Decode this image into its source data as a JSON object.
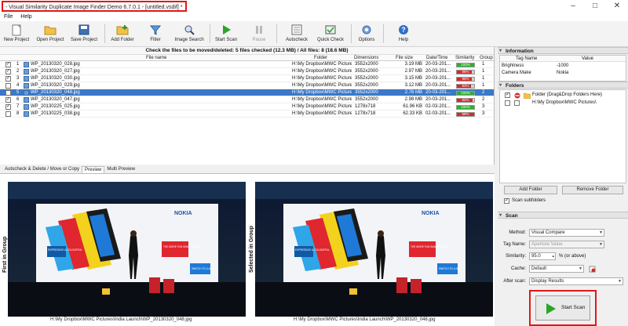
{
  "window": {
    "title": "- Visual Similarity Duplicate Image Finder Demo 6.7.0.1 - [untitled.vsdif] *",
    "minimize_glyph": "–",
    "maximize_glyph": "□",
    "close_glyph": "✕"
  },
  "menu": [
    "File",
    "Help"
  ],
  "toolbar": [
    {
      "label": "New Project",
      "icon": "new-project-icon"
    },
    {
      "label": "Open Project",
      "icon": "open-folder-icon"
    },
    {
      "label": "Save Project",
      "icon": "save-disk-icon"
    },
    {
      "label": "Add Folder",
      "icon": "add-folder-icon"
    },
    {
      "label": "Filter",
      "icon": "funnel-icon"
    },
    {
      "label": "Image Search",
      "icon": "magnifier-icon"
    },
    {
      "label": "Start Scan",
      "icon": "play-icon"
    },
    {
      "label": "Pause",
      "icon": "pause-icon"
    },
    {
      "label": "Autocheck",
      "icon": "autocheck-icon"
    },
    {
      "label": "Quick Check",
      "icon": "quick-check-icon"
    },
    {
      "label": "Options",
      "icon": "options-icon"
    },
    {
      "label": "Help",
      "icon": "help-icon"
    }
  ],
  "file_table": {
    "caption": "Check the files to be moved/deleted: 5 files checked (12.3 MB) / All files: 8 (18.6 MB)",
    "headers": {
      "filename": "File name",
      "folder": "Folder",
      "dimensions": "Dimensions",
      "filesize": "File size",
      "datetime": "Date/Time",
      "similarity": "Similarity",
      "group": "Group"
    },
    "rows": [
      {
        "checked": true,
        "index": "1",
        "name": "WP_20130320_028.jpg",
        "folder": "H:\\My Dropbox\\MWC Pictures\\Ind...",
        "dimensions": "3552x2000",
        "size": "3.19 MB",
        "date": "20-03-201...",
        "similarity": "100%",
        "sim_level": 1.0,
        "sim_color": "#2fae2f",
        "group": "1",
        "selected": false
      },
      {
        "checked": true,
        "index": "2",
        "name": "WP_20130320_027.jpg",
        "folder": "H:\\My Dropbox\\MWC Pictures\\Ind...",
        "dimensions": "3552x2000",
        "size": "2.97 MB",
        "date": "20-03-201...",
        "similarity": "86%",
        "sim_level": 0.86,
        "sim_color": "#d42a2a",
        "group": "1",
        "selected": false
      },
      {
        "checked": true,
        "index": "3",
        "name": "WP_20130320_030.jpg",
        "folder": "H:\\My Dropbox\\MWC Pictures\\Ind...",
        "dimensions": "3552x2000",
        "size": "3.15 MB",
        "date": "20-03-201...",
        "similarity": "85%",
        "sim_level": 0.85,
        "sim_color": "#d42a2a",
        "group": "1",
        "selected": false
      },
      {
        "checked": false,
        "index": "4",
        "name": "WP_20130320_029.jpg",
        "folder": "H:\\My Dropbox\\MWC Pictures\\Ind...",
        "dimensions": "3552x2000",
        "size": "3.12 MB",
        "date": "20-03-201...",
        "similarity": "83%",
        "sim_level": 0.83,
        "sim_color": "#d42a2a",
        "group": "1",
        "selected": false
      },
      {
        "checked": false,
        "index": "5",
        "name": "WP_20130320_048.jpg",
        "folder": "H:\\My Dropbox\\MWC Pictures\\Ind...",
        "dimensions": "3552x2000",
        "size": "2.76 MB",
        "date": "20-03-201...",
        "similarity": "100%",
        "sim_level": 1.0,
        "sim_color": "#2fae2f",
        "group": "2",
        "selected": true
      },
      {
        "checked": true,
        "index": "6",
        "name": "WP_20130320_047.jpg",
        "folder": "H:\\My Dropbox\\MWC Pictures\\Ind...",
        "dimensions": "3552x2000",
        "size": "2.98 MB",
        "date": "20-03-201...",
        "similarity": "92%",
        "sim_level": 0.92,
        "sim_color": "#d42a2a",
        "group": "2",
        "selected": false
      },
      {
        "checked": true,
        "index": "7",
        "name": "WP_20130225_025.jpg",
        "folder": "H:\\My Dropbox\\MWC Pictures\\Ind...",
        "dimensions": "1278x718",
        "size": "61.96 KB",
        "date": "02-03-201...",
        "similarity": "100%",
        "sim_level": 1.0,
        "sim_color": "#2fae2f",
        "group": "3",
        "selected": false
      },
      {
        "checked": false,
        "index": "8",
        "name": "WP_20130225_038.jpg",
        "folder": "H:\\My Dropbox\\MWC Pictures\\Ind...",
        "dimensions": "1278x718",
        "size": "62.33 KB",
        "date": "02-03-201...",
        "similarity": "98%",
        "sim_level": 0.98,
        "sim_color": "#d42a2a",
        "group": "3",
        "selected": false
      }
    ]
  },
  "preview": {
    "tabs": [
      "Autocheck & Delete / Move or Copy",
      "Preview",
      "Multi Preview"
    ],
    "active_tab": "Preview",
    "left_label": "First in Group",
    "right_label": "Selected in Group",
    "left_path": "H:\\My Dropbox\\MWC Pictures\\India Launch\\WP_20130320_048.jpg",
    "right_path": "H:\\My Dropbox\\MWC Pictures\\India Launch\\WP_20130320_048.jpg",
    "banner_brand": "NOKIA",
    "banner_left": "EXPRESSIVE & COLOURFUL",
    "banner_right": "THE MORE FUN SMARTPHONE",
    "banner_switch": "SWITCH TO LUMIA"
  },
  "information": {
    "title": "Information",
    "col_name": "Tag Name",
    "col_value": "Value",
    "rows": [
      {
        "name": "Brightness",
        "value": "-1000"
      },
      {
        "name": "Camera Make",
        "value": "Nokia"
      }
    ]
  },
  "folders": {
    "title": "Folders",
    "items": [
      {
        "checked": true,
        "label": "Folder (Drag&Drop Folders Here)"
      },
      {
        "checked": false,
        "label": "H:\\My Dropbox\\MWC Pictures\\"
      }
    ],
    "add_button": "Add Folder",
    "remove_button": "Remove Folder",
    "scan_subfolders": "Scan subfolders",
    "scan_subfolders_checked": true
  },
  "scan": {
    "title": "Scan",
    "method_label": "Method:",
    "method_value": "Visual Compare",
    "tag_label": "Tag Name:",
    "tag_value": "Aperture Value",
    "similarity_label": "Similarity:",
    "similarity_value": "95.0",
    "similarity_unit": "% (or above)",
    "cache_label": "Cache:",
    "cache_value": "Default",
    "after_label": "After scan:",
    "after_value": "Display Results",
    "start_button": "Start Scan"
  }
}
